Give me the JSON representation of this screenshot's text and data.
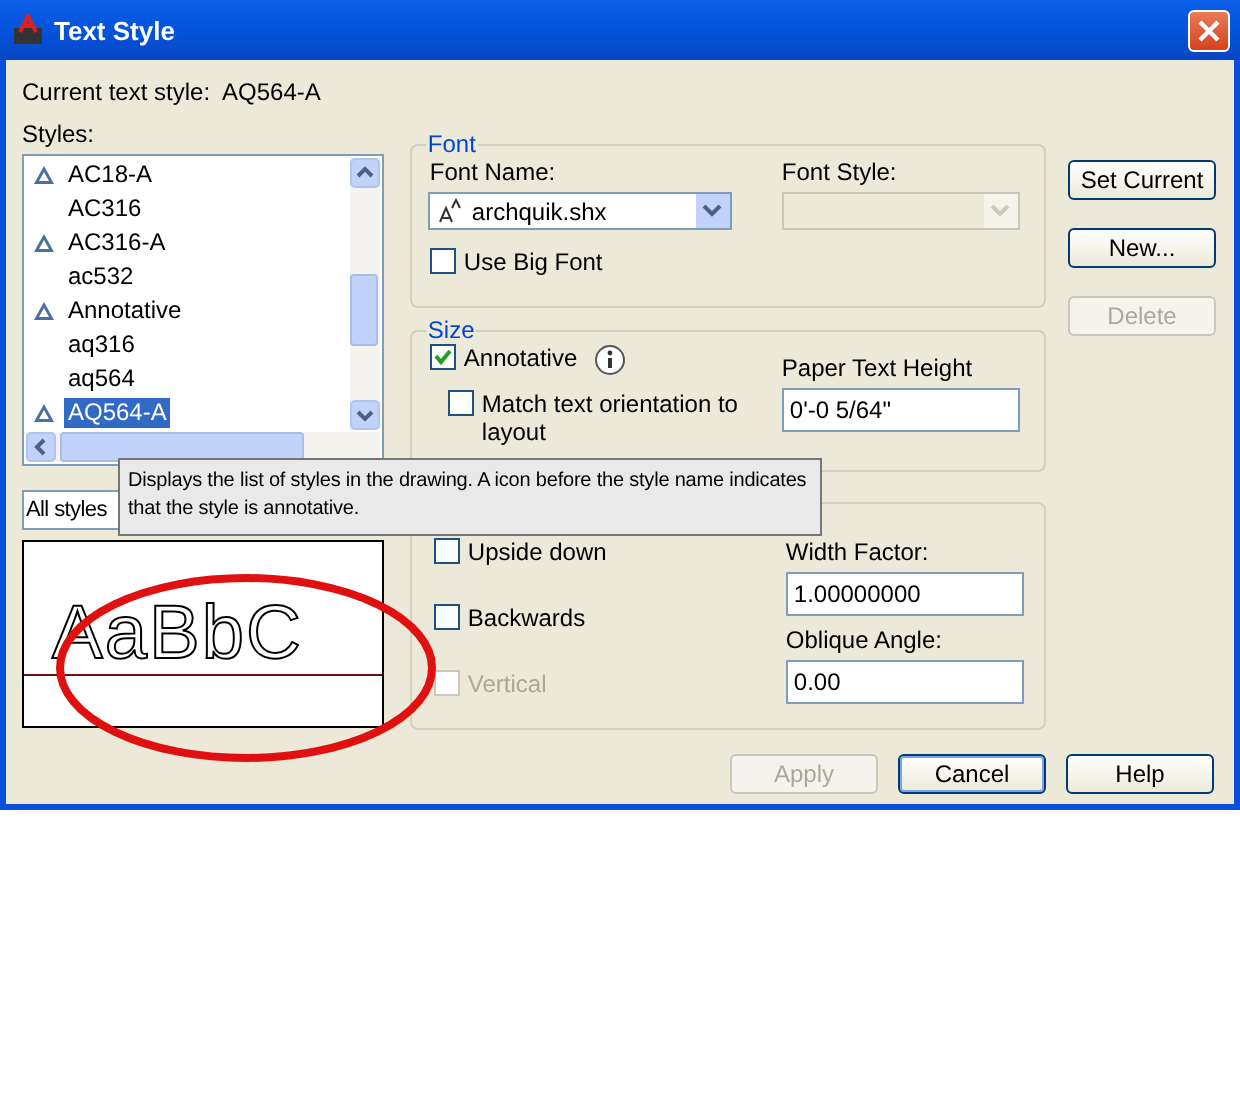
{
  "window": {
    "title": "Text Style"
  },
  "current_style": {
    "label": "Current text style:",
    "value": "AQ564-A"
  },
  "styles": {
    "label": "Styles:",
    "items": [
      {
        "name": "AC18-A",
        "annotative": true,
        "selected": false
      },
      {
        "name": "AC316",
        "annotative": false,
        "selected": false
      },
      {
        "name": "AC316-A",
        "annotative": true,
        "selected": false
      },
      {
        "name": "ac532",
        "annotative": false,
        "selected": false
      },
      {
        "name": "Annotative",
        "annotative": true,
        "selected": false
      },
      {
        "name": "aq316",
        "annotative": false,
        "selected": false
      },
      {
        "name": "aq564",
        "annotative": false,
        "selected": false
      },
      {
        "name": "AQ564-A",
        "annotative": true,
        "selected": true
      }
    ]
  },
  "filter": {
    "value": "All styles"
  },
  "preview": {
    "sample": "AaBbC"
  },
  "font": {
    "title": "Font",
    "name_label": "Font Name:",
    "name_value": "archquik.shx",
    "style_label": "Font Style:",
    "style_disabled": true,
    "big_font": {
      "label": "Use Big Font",
      "checked": false
    }
  },
  "size": {
    "title": "Size",
    "annotative": {
      "label": "Annotative",
      "checked": true
    },
    "match": {
      "label": "Match text orientation to layout",
      "checked": false
    },
    "height_label": "Paper Text Height",
    "height_value": "0'-0 5/64\""
  },
  "effects": {
    "checks": [
      {
        "label": "Upside down",
        "checked": false,
        "disabled": false
      },
      {
        "label": "Backwards",
        "checked": false,
        "disabled": false
      },
      {
        "label": "Vertical",
        "checked": false,
        "disabled": true
      }
    ],
    "width_label": "Width Factor:",
    "width_value": "1.00000000",
    "oblique_label": "Oblique Angle:",
    "oblique_value": "0.00"
  },
  "side_buttons": [
    {
      "label": "Set Current",
      "disabled": false
    },
    {
      "label": "New...",
      "disabled": false
    },
    {
      "label": "Delete",
      "disabled": true
    }
  ],
  "bottom_buttons": [
    {
      "label": "Apply",
      "disabled": true,
      "default": false
    },
    {
      "label": "Cancel",
      "disabled": false,
      "default": true
    },
    {
      "label": "Help",
      "disabled": false,
      "default": false
    }
  ],
  "tooltip": "Displays the list of styles in the drawing. A icon before the style name indicates that the style is annotative.",
  "annotation": {
    "kind": "ellipse"
  }
}
